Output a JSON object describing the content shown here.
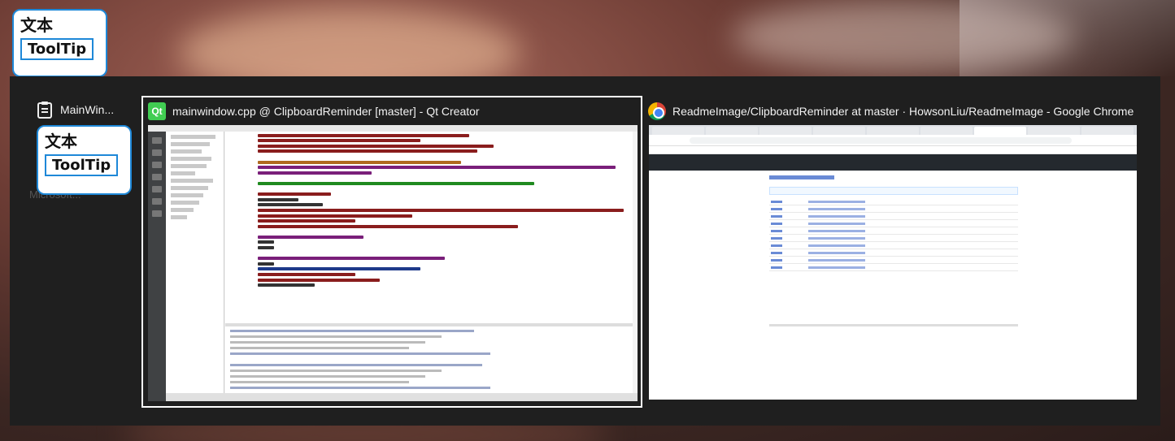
{
  "clipboard_popup": {
    "text_label": "文本",
    "tooltip_label": "ToolTip"
  },
  "switcher": {
    "tasks": [
      {
        "title": "MainWin...",
        "icon": "clipboard-icon"
      },
      {
        "title": "mainwindow.cpp @ ClipboardReminder [master] - Qt Creator",
        "icon": "qt-creator-icon"
      },
      {
        "title": "ReadmeImage/ClipboardReminder at master · HowsonLiu/ReadmeImage - Google Chrome",
        "icon": "chrome-icon"
      }
    ],
    "ghost_label": "Microsoft..."
  },
  "colors": {
    "accent": "#1e88d8",
    "switcher_bg": "#1f1f1f",
    "qt_green": "#41cd52"
  }
}
